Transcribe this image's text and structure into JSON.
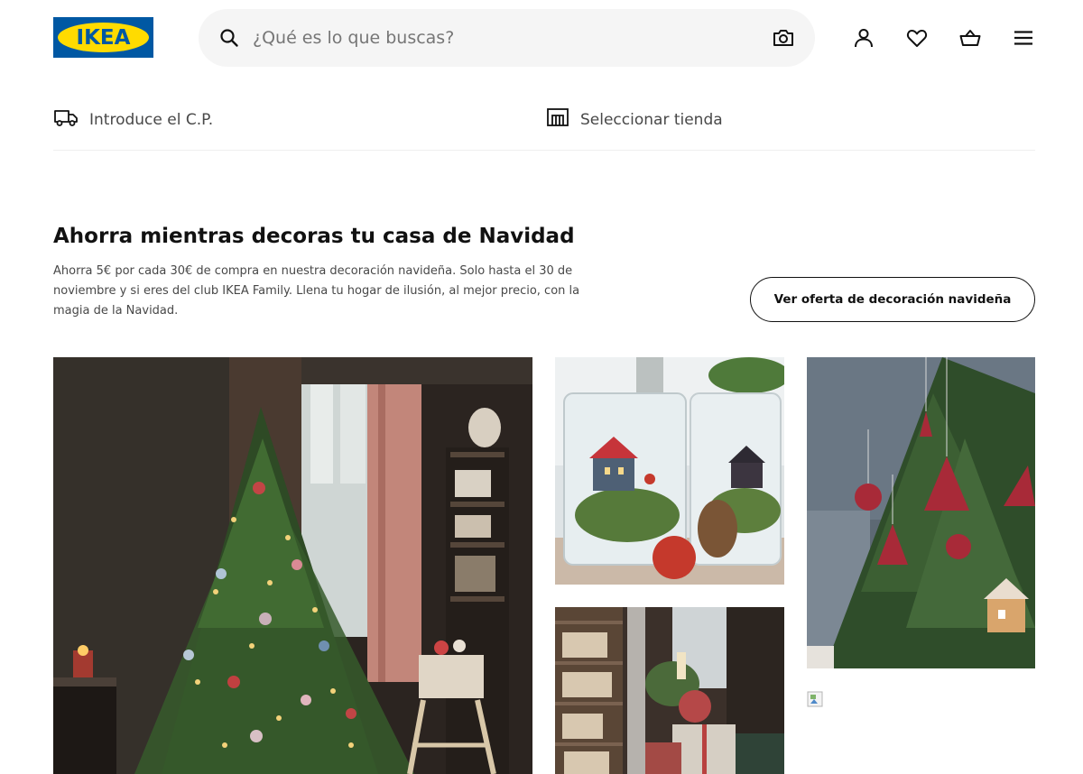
{
  "header": {
    "logo_text": "IKEA",
    "search_placeholder": "¿Qué es lo que buscas?",
    "icons": [
      "search-icon",
      "camera-icon",
      "user-icon",
      "heart-icon",
      "basket-icon",
      "menu-icon"
    ]
  },
  "utility": {
    "postcode_label": "Introduce el C.P.",
    "store_label": "Seleccionar tienda",
    "icons": [
      "truck-icon",
      "store-icon"
    ]
  },
  "promo": {
    "title": "Ahorra mientras decoras tu casa de Navidad",
    "body_line1": "Ahorra 5€ por cada 30€ de compra en nuestra decoración navideña. Solo hasta el 30 de",
    "body_line2": "noviembre y si eres del club IKEA Family. Llena tu hogar de ilusión, al mejor precio, con la",
    "body_line3": "magia de la Navidad.",
    "button_label": "Ver oferta de decoración navideña"
  },
  "colors": {
    "brand_blue": "#0058a3",
    "brand_yellow": "#ffdb00",
    "text": "#111111",
    "muted_text": "#484848",
    "search_bg": "#f5f5f5"
  }
}
